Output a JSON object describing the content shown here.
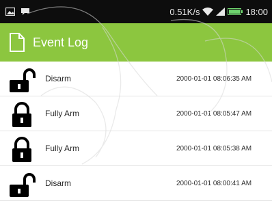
{
  "status_bar": {
    "left_icons": [
      "image-icon",
      "chat-icon"
    ],
    "speed": "0.51K/s",
    "right_icons": [
      "wifi-icon",
      "signal-icon",
      "battery-icon"
    ],
    "time": "18:00"
  },
  "app_bar": {
    "icon": "document-icon",
    "title": "Event Log"
  },
  "events": [
    {
      "icon": "unlocked-padlock-icon",
      "action": "Disarm",
      "timestamp": "2000-01-01 08:06:35 AM"
    },
    {
      "icon": "locked-padlock-icon",
      "action": "Fully Arm",
      "timestamp": "2000-01-01 08:05:47 AM"
    },
    {
      "icon": "locked-padlock-icon",
      "action": "Fully Arm",
      "timestamp": "2000-01-01 08:05:38 AM"
    },
    {
      "icon": "unlocked-padlock-icon",
      "action": "Disarm",
      "timestamp": "2000-01-01 08:00:41 AM"
    }
  ],
  "colors": {
    "status_bar": "#0d0d0d",
    "app_bar": "#8cc63f",
    "background": "#ffffff",
    "battery": "#6ed36e"
  }
}
